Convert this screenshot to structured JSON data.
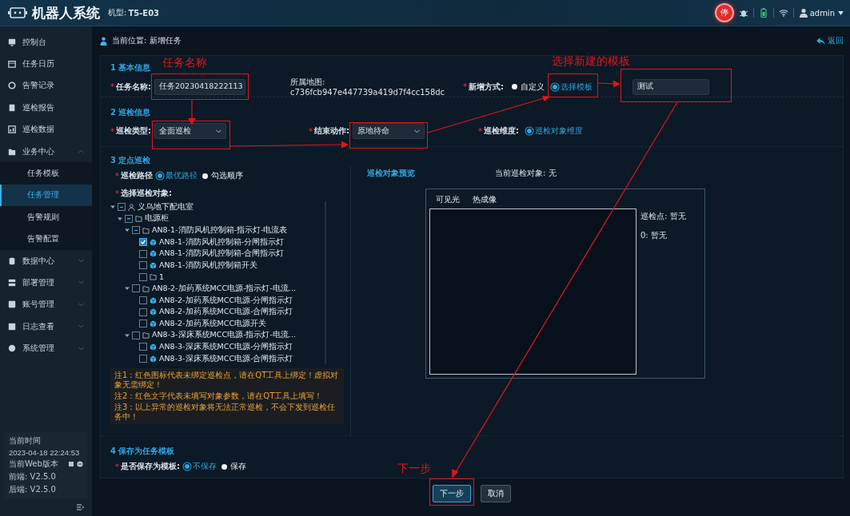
{
  "header": {
    "title": "机器人系统",
    "model_label": "机型:",
    "model": "T5-E03",
    "stop_button": "停",
    "user": "admin"
  },
  "sidebar": {
    "items": [
      {
        "label": "控制台",
        "kind": "link",
        "selected": false
      },
      {
        "label": "任务日历",
        "kind": "link",
        "selected": false
      },
      {
        "label": "告警记录",
        "kind": "link",
        "selected": false
      },
      {
        "label": "巡检报告",
        "kind": "link",
        "selected": false
      },
      {
        "label": "巡检数据",
        "kind": "link",
        "selected": false
      },
      {
        "label": "业务中心",
        "kind": "group",
        "expanded": true,
        "children": [
          {
            "label": "任务模板",
            "selected": false
          },
          {
            "label": "任务管理",
            "selected": true
          },
          {
            "label": "告警规则",
            "selected": false
          },
          {
            "label": "告警配置",
            "selected": false
          }
        ]
      },
      {
        "label": "数据中心",
        "kind": "group",
        "expanded": false
      },
      {
        "label": "部署管理",
        "kind": "group",
        "expanded": false
      },
      {
        "label": "账号管理",
        "kind": "group",
        "expanded": false
      },
      {
        "label": "日志查看",
        "kind": "group",
        "expanded": false
      },
      {
        "label": "系统管理",
        "kind": "group",
        "expanded": false
      }
    ],
    "info": {
      "time_label": "当前时间",
      "time": "2023-04-18 22:24:53",
      "version_label": "当前Web版本",
      "frontend_label": "前端:",
      "frontend": "V2.5.0",
      "backend_label": "后端:",
      "backend": "V2.5.0"
    }
  },
  "breadcrumb": {
    "label": "当前位置:",
    "value": "新增任务"
  },
  "back_link": "返回",
  "basic_info": {
    "title": "1 基本信息",
    "task_name": {
      "mark": "*",
      "label": "任务名称:",
      "value": "任务20230418222113"
    },
    "map": {
      "label": "所属地图:",
      "value": "c736fcb947e447739a419d7f4cc158dc"
    },
    "create_mode": {
      "mark": "*",
      "label": "新增方式:",
      "options": [
        {
          "label": "自定义",
          "selected": false
        },
        {
          "label": "选择模板",
          "selected": true
        }
      ]
    },
    "template": {
      "value": "测试"
    }
  },
  "patrol_info": {
    "title": "2 巡检信息",
    "patrol_type": {
      "mark": "*",
      "label": "巡检类型:",
      "value": "全面巡检"
    },
    "end_action": {
      "mark": "*",
      "label": "结束动作:",
      "value": "原地待命"
    },
    "dimension": {
      "mark": "*",
      "label": "巡检维度:",
      "options": [
        {
          "label": "巡检对象维度",
          "selected": true
        }
      ]
    }
  },
  "fixed_patrol": {
    "title": "3 定点巡检",
    "route": {
      "mark": "*",
      "label": "巡检路径",
      "options": [
        {
          "label": "最优路径",
          "selected": true
        },
        {
          "label": "勾选顺序",
          "selected": false
        }
      ]
    },
    "object_label": {
      "mark": "*",
      "label": "选择巡检对象:"
    },
    "tree": [
      {
        "label": "义乌地下配电室",
        "kind": "site",
        "checked": false,
        "partial": true,
        "expanded": true,
        "children": [
          {
            "label": "电源柜",
            "kind": "folder",
            "checked": false,
            "partial": true,
            "expanded": true,
            "children": [
              {
                "label": "AN8-1-消防风机控制箱-指示灯-电流表",
                "kind": "folder",
                "checked": false,
                "partial": true,
                "expanded": true,
                "children": [
                  {
                    "label": "AN8-1-消防风机控制箱-分闸指示灯",
                    "kind": "device",
                    "checked": true,
                    "partial": false
                  },
                  {
                    "label": "AN8-1-消防风机控制箱-合闸指示灯",
                    "kind": "device",
                    "checked": false,
                    "partial": false
                  },
                  {
                    "label": "AN8-1-消防风机控制箱开关",
                    "kind": "device",
                    "checked": false,
                    "partial": false
                  },
                  {
                    "label": "1",
                    "kind": "folder",
                    "checked": false,
                    "partial": false
                  }
                ]
              },
              {
                "label": "AN8-2-加药系统MCC电源-指示灯-电流...",
                "kind": "folder",
                "checked": false,
                "partial": false,
                "expanded": true,
                "children": [
                  {
                    "label": "AN8-2-加药系统MCC电源-分闸指示灯",
                    "kind": "device",
                    "checked": false,
                    "partial": false
                  },
                  {
                    "label": "AN8-2-加药系统MCC电源-合闸指示灯",
                    "kind": "device",
                    "checked": false,
                    "partial": false
                  },
                  {
                    "label": "AN8-2-加药系统MCC电源开关",
                    "kind": "device",
                    "checked": false,
                    "partial": false
                  }
                ]
              },
              {
                "label": "AN8-3-深床系统MCC电源-指示灯-电流...",
                "kind": "folder",
                "checked": false,
                "partial": false,
                "expanded": true,
                "children": [
                  {
                    "label": "AN8-3-深床系统MCC电源-分闸指示灯",
                    "kind": "device",
                    "checked": false,
                    "partial": false
                  },
                  {
                    "label": "AN8-3-深床系统MCC电源-合闸指示灯",
                    "kind": "device",
                    "checked": false,
                    "partial": false
                  }
                ]
              }
            ]
          }
        ]
      }
    ],
    "notes": [
      "注1：红色图标代表未绑定巡检点，请在QT工具上绑定！虚拟对象无需绑定！",
      "注2：红色文字代表未填写对象参数，请在QT工具上填写！",
      "注3：以上异常的巡检对象将无法正常巡检，不会下发到巡检任务中！"
    ],
    "preview": {
      "title": "巡检对象预览",
      "current_label": "当前巡检对象:",
      "current": "无",
      "tabs": [
        {
          "label": "可见光",
          "selected": false
        },
        {
          "label": "热成像",
          "selected": false
        }
      ],
      "points": [
        {
          "label": "巡检点:",
          "value": "暂无"
        },
        {
          "label": "0:",
          "value": "暂无"
        }
      ]
    }
  },
  "save_template": {
    "title": "4 保存为任务模板",
    "save": {
      "mark": "*",
      "label": "是否保存为模板:",
      "options": [
        {
          "label": "不保存",
          "selected": true
        },
        {
          "label": "保存",
          "selected": false
        }
      ]
    }
  },
  "buttons": [
    {
      "label": "下一步",
      "kind": "primary"
    },
    {
      "label": "取消",
      "kind": "secondary"
    }
  ],
  "annotations": {
    "labels": [
      "任务名称",
      "选择新建的模板",
      "下一步"
    ]
  }
}
